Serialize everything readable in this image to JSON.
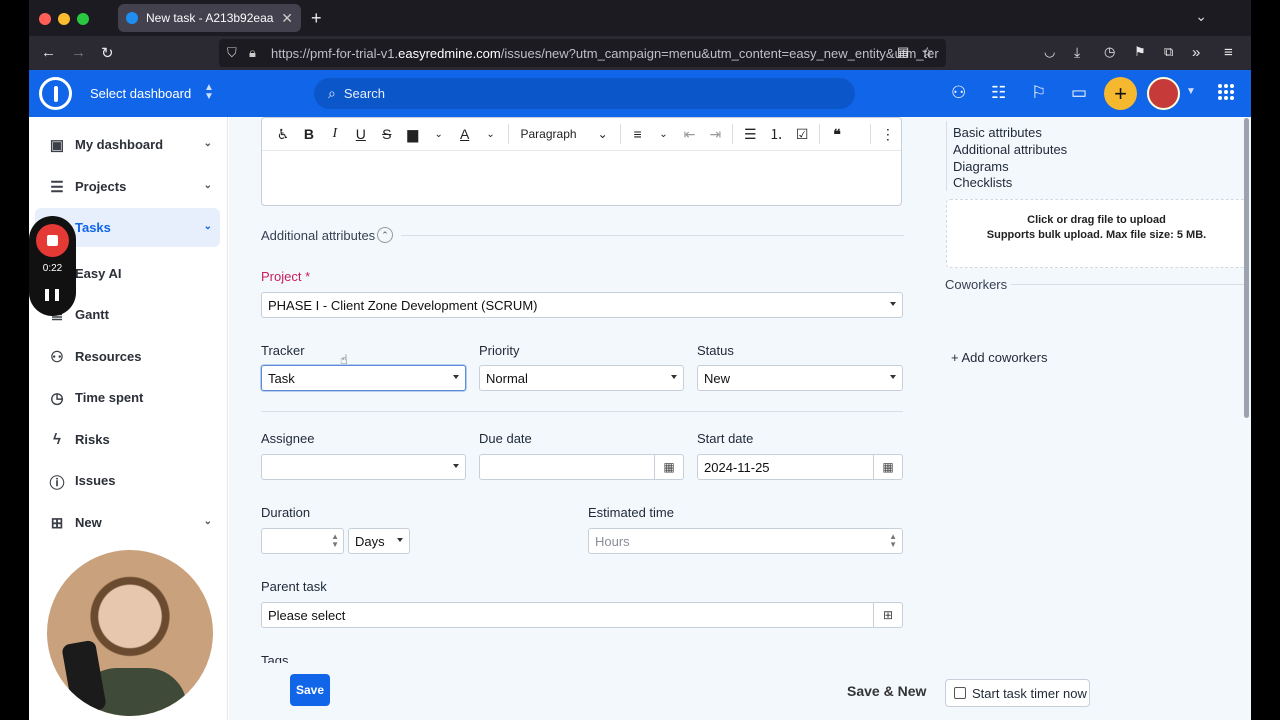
{
  "browser": {
    "tab_title": "New task - A213b92eaa",
    "url_prefix": "https://pmf-for-trial-v1.",
    "url_domain": "easyredmine.com",
    "url_suffix": "/issues/new?utm_campaign=menu&utm_content=easy_new_entity&utm_ter"
  },
  "header": {
    "dashboard_label": "Select dashboard",
    "search_placeholder": "Search"
  },
  "sidebar": {
    "items": [
      {
        "label": "My dashboard",
        "icon": "dashboard-icon"
      },
      {
        "label": "Projects",
        "icon": "projects-icon"
      },
      {
        "label": "Tasks",
        "icon": "tasks-icon"
      },
      {
        "label": "Easy AI",
        "icon": "ai-icon"
      },
      {
        "label": "Gantt",
        "icon": "gantt-icon"
      },
      {
        "label": "Resources",
        "icon": "resources-icon"
      },
      {
        "label": "Time spent",
        "icon": "clock-icon"
      },
      {
        "label": "Risks",
        "icon": "risks-icon"
      },
      {
        "label": "Issues",
        "icon": "issues-icon"
      },
      {
        "label": "New",
        "icon": "new-icon"
      }
    ]
  },
  "recorder": {
    "time": "0:22"
  },
  "editor": {
    "format": "Paragraph"
  },
  "form": {
    "additional_attributes": "Additional attributes",
    "project_label": "Project",
    "project_required": "*",
    "project_value": "PHASE I - Client Zone Development (SCRUM)",
    "tracker_label": "Tracker",
    "tracker_value": "Task",
    "priority_label": "Priority",
    "priority_value": "Normal",
    "status_label": "Status",
    "status_value": "New",
    "assignee_label": "Assignee",
    "assignee_value": "",
    "due_date_label": "Due date",
    "due_date_value": "",
    "start_date_label": "Start date",
    "start_date_value": "2024-11-25",
    "duration_label": "Duration",
    "duration_unit": "Days",
    "estimated_label": "Estimated time",
    "estimated_placeholder": "Hours",
    "parent_label": "Parent task",
    "parent_value": "Please select",
    "tags_label": "Tags",
    "save": "Save",
    "save_new": "Save & New",
    "timer": "Start task timer now"
  },
  "right": {
    "links": [
      "Basic attributes",
      "Additional attributes",
      "Diagrams",
      "Checklists"
    ],
    "upload_line1": "Click or drag file to upload",
    "upload_line2": "Supports bulk upload. Max file size: 5 MB.",
    "coworkers": "Coworkers",
    "add_coworkers": "+ Add coworkers"
  },
  "colors": {
    "brand": "#1065e8",
    "accent": "#f5b82e",
    "required": "#c81e5b"
  }
}
